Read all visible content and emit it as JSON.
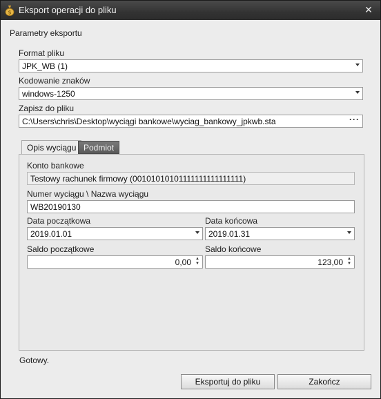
{
  "window": {
    "title": "Eksport operacji do pliku",
    "close_glyph": "✕",
    "icon": "money-bag-icon"
  },
  "section_title": "Parametry eksportu",
  "format": {
    "label": "Format pliku",
    "value": "JPK_WB (1)"
  },
  "encoding": {
    "label": "Kodowanie znaków",
    "value": "windows-1250"
  },
  "save_to": {
    "label": "Zapisz do pliku",
    "value": "C:\\Users\\chris\\Desktop\\wyciągi bankowe\\wyciag_bankowy_jpkwb.sta",
    "browse_glyph": "···"
  },
  "tabs": [
    {
      "label": "Opis wyciągu",
      "active": true
    },
    {
      "label": "Podmiot",
      "active": false
    }
  ],
  "statement": {
    "account_label": "Konto bankowe",
    "account_value": "Testowy rachunek firmowy (00101010101111111111111111)",
    "number_label": "Numer wyciągu \\ Nazwa wyciągu",
    "number_value": "WB20190130",
    "start_date_label": "Data początkowa",
    "start_date_value": "2019.01.01",
    "end_date_label": "Data końcowa",
    "end_date_value": "2019.01.31",
    "start_balance_label": "Saldo początkowe",
    "start_balance_value": "0,00",
    "end_balance_label": "Saldo końcowe",
    "end_balance_value": "123,00"
  },
  "status": "Gotowy.",
  "buttons": {
    "export": "Eksportuj do pliku",
    "finish": "Zakończ"
  },
  "spin_glyphs": {
    "up": "▲",
    "down": "▼"
  }
}
